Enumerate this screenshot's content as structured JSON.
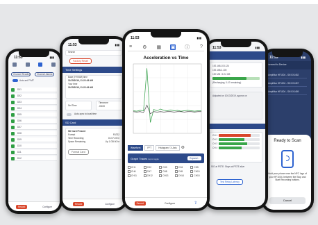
{
  "status_time": "11:53",
  "phones": {
    "left_far": {
      "tabs": [
        "Channel Readings",
        "Channel Alarms"
      ],
      "toggle_label": "Auto-set 'FIVE'",
      "rows": [
        "D01",
        "D02",
        "D03",
        "D04",
        "D05",
        "D06",
        "D07",
        "D08",
        "D09",
        "D10",
        "D11",
        "D12"
      ],
      "bottom_left": "Record",
      "bottom_right": "Configure"
    },
    "left": {
      "search_label": "Search",
      "reset_button": "Factory Reset",
      "time_section": "Time Settings",
      "time_lines": [
        "Base (HH:MM) time",
        "11/15/2019, 11:22:43 AM",
        "Your time",
        "11/15/2019, 11:22:43 AM"
      ],
      "set_time": "Set Time",
      "timezone_label": "Timezone",
      "timezone_value": "-08:00",
      "auto_sync": "Auto-sync to local time",
      "sd_section": "SD Card",
      "sd_title": "SD Card Present",
      "sd_lines": [
        {
          "k": "Format",
          "v": "FAT32"
        },
        {
          "k": "Time Recording",
          "v": "01:07:23 hr"
        },
        {
          "k": "Space Remaining",
          "v": "Up 1 GB 60 hr"
        }
      ],
      "format_button": "Format Card",
      "record_button": "Record",
      "bottom_right": "Configure"
    },
    "center": {
      "chart_title": "Acceleration vs Time",
      "tabs": [
        "Waveform",
        "FFT",
        "Histogram / X-Axis"
      ],
      "graph_panel_label": "Graph Traces",
      "graph_panel_sub": "tap to toggle",
      "expand_button": "Expand ↕",
      "channels": [
        "CH1",
        "CH2",
        "CH3",
        "CH4",
        "CH5",
        "CH6",
        "CH7",
        "CH8",
        "CH9",
        "CH10",
        "CH11",
        "CH12",
        "CH13",
        "CH14",
        "CH15"
      ],
      "bottom_left": "Record",
      "bottom_middle": "Configure"
    },
    "right": {
      "lines": [
        "192.168.103.124",
        "192.168.2.100",
        "190 MB / 2.24 GB"
      ],
      "status_line": "(Recharging, 0.47 remaining)",
      "note": "Adjusted on 10/13/2019, approx on",
      "levels": [
        {
          "label": "CH 1",
          "value": 0.78,
          "color": "#d9462b"
        },
        {
          "label": "CH 2",
          "value": 0.62,
          "color": "#3aa64a"
        },
        {
          "label": "CH 3",
          "value": 0.7,
          "color": "#3aa64a"
        },
        {
          "label": "CH 4",
          "value": 0.55,
          "color": "#3aa64a"
        }
      ],
      "battery_fraction": 0.72,
      "signal_note": "SIG at PSTE: Stays at PSTE alive",
      "bottom_button": "Test Relay Latency"
    },
    "far_right": {
      "header": "Connect to Device",
      "devices": [
        "Ampliflux HF1004 - SN 0X1452",
        "Ampliflux HF1004 - SN 0X1457",
        "Ampliflux HF1004 - SN 0X1459"
      ],
      "sheet_title": "Ready to Scan",
      "sheet_text": "Hold your phone near the NFC logo of your HF1004, between the Stop and Start Recording buttons.",
      "cancel_button": "Cancel"
    }
  },
  "chart_data": {
    "type": "line",
    "title": "Acceleration vs Time",
    "series": [
      {
        "color": "#2f9e44",
        "x": [
          0,
          50,
          100,
          150,
          200,
          250,
          300,
          350,
          400,
          450,
          500,
          550,
          600,
          650,
          700,
          750,
          800,
          850,
          900,
          950,
          1000
        ],
        "y": [
          0.02,
          0.01,
          0.03,
          0.02,
          1.0,
          -0.25,
          0.05,
          0.02,
          0.06,
          0.03,
          0.02,
          0.04,
          0.02,
          0.03,
          0.01,
          0.02,
          0.03,
          0.02,
          0.01,
          0.02,
          0.02
        ]
      },
      {
        "color": "#444444",
        "x": [
          0,
          50,
          100,
          150,
          200,
          250,
          300,
          350,
          400,
          450,
          500,
          550,
          600,
          650,
          700,
          750,
          800,
          850,
          900,
          950,
          1000
        ],
        "y": [
          0.0,
          -0.01,
          0.0,
          -0.02,
          0.15,
          -0.05,
          0.0,
          -0.01,
          0.0,
          -0.01,
          0.0,
          0.0,
          -0.01,
          0.0,
          0.0,
          -0.01,
          0.0,
          0.0,
          -0.01,
          0.0,
          0.0
        ]
      }
    ],
    "xlim": [
      0,
      1000
    ],
    "ylim": [
      -0.5,
      1.1
    ]
  },
  "colors": {
    "accent": "#2d4a8a",
    "primary": "#2d63d0",
    "danger": "#d9462b",
    "ok": "#3aa64a"
  }
}
